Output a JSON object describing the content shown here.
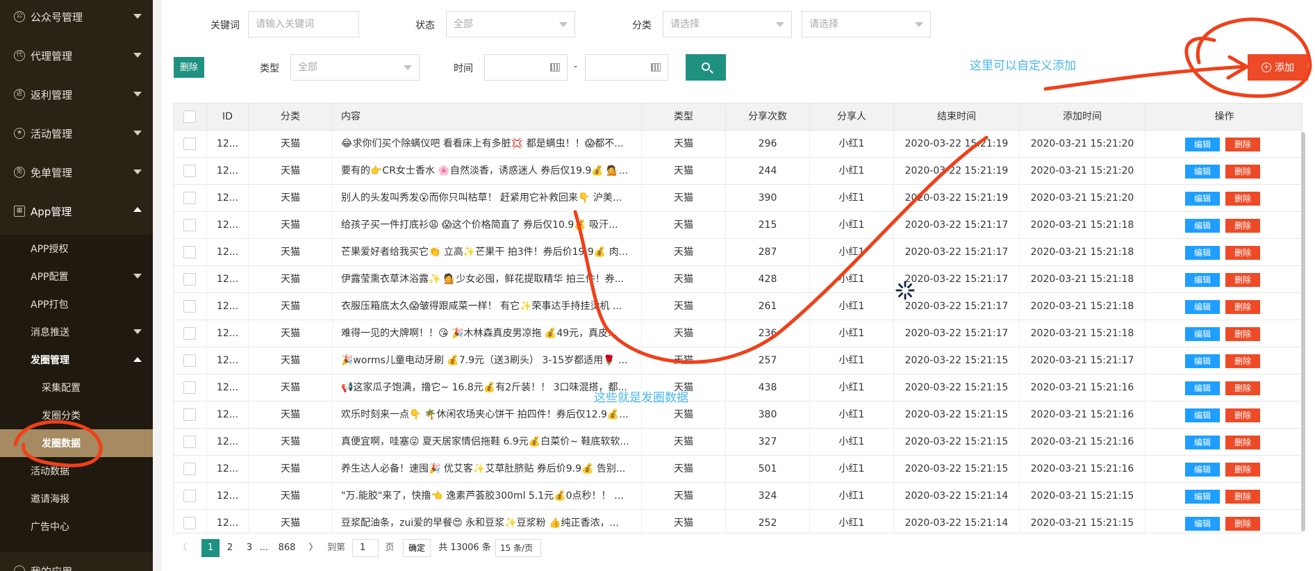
{
  "sidebar": {
    "top_menus": [
      {
        "label": "公众号管理",
        "icon": "公"
      },
      {
        "label": "代理管理",
        "icon": "代"
      },
      {
        "label": "返利管理",
        "icon": "返"
      },
      {
        "label": "活动管理",
        "icon": "★"
      },
      {
        "label": "免单管理",
        "icon": "免"
      },
      {
        "label": "App管理",
        "icon": "▦"
      }
    ],
    "app_sub": [
      "APP授权",
      "APP配置",
      "APP打包",
      "消息推送",
      "发圈管理"
    ],
    "circle_sub": [
      "采集配置",
      "发圈分类",
      "发圈数据"
    ],
    "other_sub": [
      "活动数据",
      "邀请海报",
      "广告中心"
    ],
    "bottom_menu": "我的应用"
  },
  "filters": {
    "keyword_label": "关键词",
    "keyword_placeholder": "请输入关键词",
    "status_label": "状态",
    "status_value": "全部",
    "category_label": "分类",
    "category_placeholder": "请选择",
    "category2_placeholder": "请选择",
    "type_label": "类型",
    "type_value": "全部",
    "time_label": "时间",
    "time_sep": "-",
    "delete_label": "删除",
    "add_label": "添加"
  },
  "annotations": {
    "add_hint": "这里可以自定义添加",
    "data_hint": "这些就是发圈数据"
  },
  "table": {
    "headers": [
      "ID",
      "分类",
      "内容",
      "类型",
      "分享次数",
      "分享人",
      "结束时间",
      "添加时间",
      "操作"
    ],
    "edit_label": "编辑",
    "delete_label": "删除",
    "rows": [
      {
        "id": "12...",
        "cat": "天猫",
        "content": "😂求你们买个除螨仪吧 看看床上有多脏💢 都是螨虫！！😱都不...",
        "type": "天猫",
        "shares": "296",
        "sharer": "小红1",
        "end": "2020-03-22 15:21:19",
        "added": "2020-03-21 15:21:20"
      },
      {
        "id": "12...",
        "cat": "天猫",
        "content": "要有的👉CR女士香水 🌸自然淡香，诱惑迷人 券后仅19.9💰 💁...",
        "type": "天猫",
        "shares": "244",
        "sharer": "小红1",
        "end": "2020-03-22 15:21:19",
        "added": "2020-03-21 15:21:20"
      },
      {
        "id": "12...",
        "cat": "天猫",
        "content": "别人的头发叫秀发😮而你只叫枯草！ 赶紧用它补救回来👇 沪美...",
        "type": "天猫",
        "shares": "390",
        "sharer": "小红1",
        "end": "2020-03-22 15:21:19",
        "added": "2020-03-21 15:21:20"
      },
      {
        "id": "12...",
        "cat": "天猫",
        "content": "给孩子买一件打底衫😩 😱这个价格简直了 券后仅10.9💰 吸汗...",
        "type": "天猫",
        "shares": "215",
        "sharer": "小红1",
        "end": "2020-03-22 15:21:17",
        "added": "2020-03-21 15:21:18"
      },
      {
        "id": "12...",
        "cat": "天猫",
        "content": "芒果爱好者给我买它👏 立高✨芒果干 拍3件！券后价19.9💰 肉...",
        "type": "天猫",
        "shares": "287",
        "sharer": "小红1",
        "end": "2020-03-22 15:21:17",
        "added": "2020-03-21 15:21:18"
      },
      {
        "id": "12...",
        "cat": "天猫",
        "content": "伊露莹熏衣草沐浴露✨ 💁少女必囤，鲜花提取精华 拍三件！券...",
        "type": "天猫",
        "shares": "428",
        "sharer": "小红1",
        "end": "2020-03-22 15:21:17",
        "added": "2020-03-21 15:21:18"
      },
      {
        "id": "12...",
        "cat": "天猫",
        "content": "衣服压箱底太久😱皱得跟咸菜一样！ 有它✨荣事达手持挂烫机 ...",
        "type": "天猫",
        "shares": "261",
        "sharer": "小红1",
        "end": "2020-03-22 15:21:17",
        "added": "2020-03-21 15:21:18"
      },
      {
        "id": "12...",
        "cat": "天猫",
        "content": "难得一见的大牌啊！！😘 🎉木林森真皮男凉拖 💰49元，真皮...",
        "type": "天猫",
        "shares": "236",
        "sharer": "小红1",
        "end": "2020-03-22 15:21:17",
        "added": "2020-03-21 15:21:18"
      },
      {
        "id": "12...",
        "cat": "天猫",
        "content": "🎉worms儿童电动牙刷 💰7.9元（送3刷头） 3-15岁都适用🌹 ...",
        "type": "天猫",
        "shares": "257",
        "sharer": "小红1",
        "end": "2020-03-22 15:21:15",
        "added": "2020-03-21 15:21:17"
      },
      {
        "id": "12...",
        "cat": "天猫",
        "content": "📢这家瓜子饱满，撸它~ 16.8元💰有2斤装！！ 3口味混搭，都...",
        "type": "天猫",
        "shares": "438",
        "sharer": "小红1",
        "end": "2020-03-22 15:21:15",
        "added": "2020-03-21 15:21:16"
      },
      {
        "id": "12...",
        "cat": "天猫",
        "content": "欢乐时刻来一点👇 🌴休闲农场夹心饼干 拍四件！券后仅12.9💰...",
        "type": "天猫",
        "shares": "380",
        "sharer": "小红1",
        "end": "2020-03-22 15:21:15",
        "added": "2020-03-21 15:21:16"
      },
      {
        "id": "12...",
        "cat": "天猫",
        "content": "真便宜啊，哇塞😜 夏天居家情侣拖鞋 6.9元💰白菜价~ 鞋底软软...",
        "type": "天猫",
        "shares": "327",
        "sharer": "小红1",
        "end": "2020-03-22 15:21:15",
        "added": "2020-03-21 15:21:16"
      },
      {
        "id": "12...",
        "cat": "天猫",
        "content": "养生达人必备！速囤🎉 优艾客✨艾草肚脐贴 券后价9.9💰 告别...",
        "type": "天猫",
        "shares": "501",
        "sharer": "小红1",
        "end": "2020-03-22 15:21:15",
        "added": "2020-03-21 15:21:16"
      },
      {
        "id": "12...",
        "cat": "天猫",
        "content": "\"万.能胶\"来了，快撸👈 逸素芦荟胶300ml 5.1元💰0点秒！！ 祛...",
        "type": "天猫",
        "shares": "324",
        "sharer": "小红1",
        "end": "2020-03-22 15:21:14",
        "added": "2020-03-21 15:21:15"
      },
      {
        "id": "12...",
        "cat": "天猫",
        "content": "豆浆配油条，zui爱的早餐😍 永和豆浆✨豆浆粉 👍纯正香浓，...",
        "type": "天猫",
        "shares": "252",
        "sharer": "小红1",
        "end": "2020-03-22 15:21:14",
        "added": "2020-03-21 15:21:15"
      }
    ]
  },
  "pagination": {
    "prev": "〈",
    "pages": [
      "1",
      "2",
      "3"
    ],
    "ellipsis": "...",
    "last": "868",
    "next": "〉",
    "goto_label": "到第",
    "goto_value": "1",
    "page_unit": "页",
    "confirm_label": "确定",
    "total_label": "共 13006 条",
    "per_page": "15 条/页"
  },
  "colors": {
    "sidebar_bg": "#2b2216",
    "active_item": "#a58a62",
    "primary": "#1e9180",
    "edit": "#1e9fff",
    "danger": "#ed4b27",
    "annotation_ink": "#f0401a",
    "annotation_text": "#4ab6ef"
  }
}
